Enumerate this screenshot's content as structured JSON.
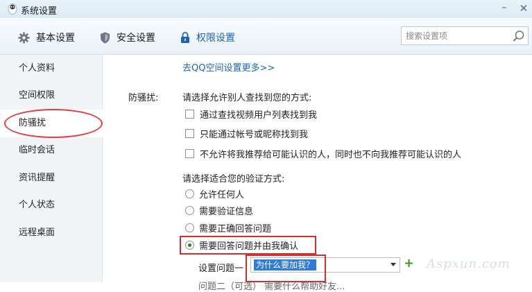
{
  "window": {
    "title": "系统设置",
    "minimize": "–",
    "close": "✕"
  },
  "tabs": [
    {
      "label": "基本设置",
      "icon": "gear-icon"
    },
    {
      "label": "安全设置",
      "icon": "shield-icon"
    },
    {
      "label": "权限设置",
      "icon": "lock-icon",
      "active": true
    }
  ],
  "search": {
    "placeholder": "搜索设置项",
    "icon": "search-icon"
  },
  "sidebar": {
    "items": [
      {
        "label": "个人资料"
      },
      {
        "label": "空间权限"
      },
      {
        "label": "防骚扰",
        "active": true
      },
      {
        "label": "临时会话"
      },
      {
        "label": "资讯提醒"
      },
      {
        "label": "个人状态"
      },
      {
        "label": "远程桌面"
      }
    ]
  },
  "content": {
    "link_more": "去QQ空间设置更多>>",
    "section_label": "防骚扰:",
    "find_heading": "请选择允许别人查找到您的方式:",
    "find_options": [
      {
        "label": "通过查找视频用户列表找到我",
        "checked": false
      },
      {
        "label": "只能通过帐号或昵称找到我",
        "checked": false
      },
      {
        "label": "不允许将我推荐给可能认识的人，同时也不向我推荐可能认识的人",
        "checked": false
      }
    ],
    "verify_heading": "请选择适合您的验证方式:",
    "verify_options": [
      {
        "label": "允许任何人",
        "checked": false
      },
      {
        "label": "需要验证信息",
        "checked": false
      },
      {
        "label": "需要正确回答问题",
        "checked": false
      },
      {
        "label": "需要回答问题并由我确认",
        "checked": true
      }
    ],
    "question_label": "设置问题一",
    "question_value": "为什么要加我？",
    "add_symbol": "+",
    "cut_text": "问题二（可选）                              需要什么帮助好友..."
  },
  "annotation_color": "#e02a2a",
  "watermark": "Aspxun.com"
}
